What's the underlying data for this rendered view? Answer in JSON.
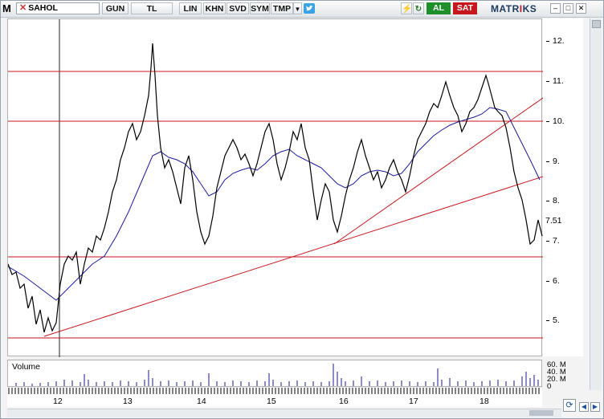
{
  "toolbar": {
    "logo": "M",
    "symbol": "SAHOL",
    "period_label": "GUN",
    "currency_label": "TL",
    "linear_label": "LIN",
    "khn_label": "KHN",
    "svd_label": "SVD",
    "sym_label": "SYM",
    "tmp_label": "TMP",
    "buy_label": "AL",
    "sell_label": "SAT",
    "brand": "MATRIKS",
    "icons": [
      "dropdown-arrow-icon",
      "twitter-icon",
      "flash-icon",
      "refresh-icon",
      "minimize-icon",
      "restore-icon",
      "close-icon"
    ]
  },
  "y_axis": {
    "ticks": [
      "12.",
      "11.",
      "10.",
      "9.",
      "8.",
      "7.",
      "6.",
      "5."
    ],
    "last_price": "7.51"
  },
  "volume": {
    "label": "Volume",
    "ticks": [
      "60. M",
      "40. M",
      "20. M",
      "0"
    ]
  },
  "x_axis": {
    "ticks": [
      "12",
      "13",
      "14",
      "15",
      "16",
      "17",
      "18"
    ]
  },
  "colors": {
    "price": "#000000",
    "moving_average": "#1a1a9a",
    "lines": "#c8161d",
    "buy": "#1f8f2a",
    "sell": "#c8161d"
  }
}
